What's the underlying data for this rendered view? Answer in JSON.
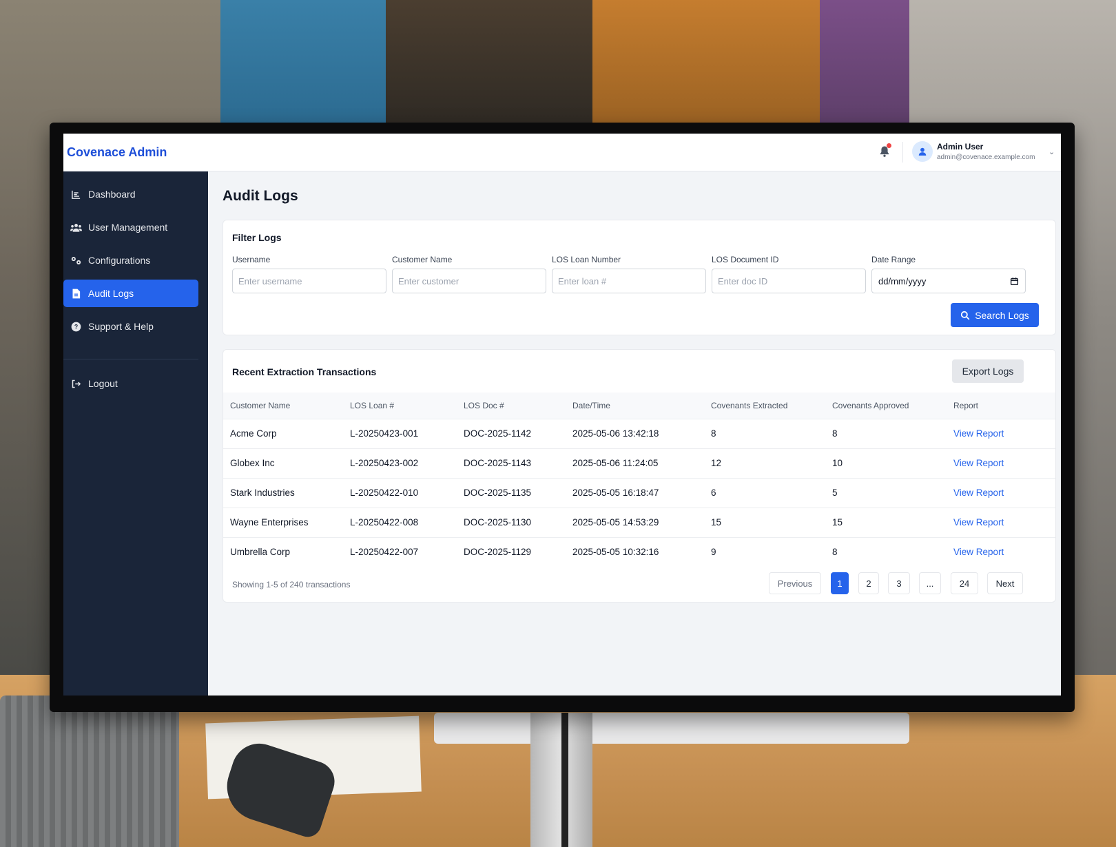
{
  "app": {
    "brand": "Covenace Admin"
  },
  "header": {
    "user_name": "Admin User",
    "user_email": "admin@covenace.example.com",
    "notification_dot_color": "#ef4444"
  },
  "sidebar": {
    "items": [
      {
        "label": "Dashboard",
        "icon": "chart-icon",
        "active": false
      },
      {
        "label": "User Management",
        "icon": "users-icon",
        "active": false
      },
      {
        "label": "Configurations",
        "icon": "gears-icon",
        "active": false
      },
      {
        "label": "Audit Logs",
        "icon": "file-icon",
        "active": true
      },
      {
        "label": "Support & Help",
        "icon": "question-icon",
        "active": false
      }
    ],
    "logout": {
      "label": "Logout",
      "icon": "logout-icon"
    }
  },
  "page": {
    "title": "Audit Logs"
  },
  "filters": {
    "title": "Filter Logs",
    "fields": [
      {
        "label": "Username",
        "placeholder": "Enter username"
      },
      {
        "label": "Customer Name",
        "placeholder": "Enter customer"
      },
      {
        "label": "LOS Loan Number",
        "placeholder": "Enter loan #"
      },
      {
        "label": "LOS Document ID",
        "placeholder": "Enter doc ID"
      }
    ],
    "date_range": {
      "label": "Date Range",
      "value": "dd/mm/yyyy"
    },
    "search_label": "Search Logs"
  },
  "transactions": {
    "title": "Recent Extraction Transactions",
    "export_label": "Export Logs",
    "columns": [
      "Customer Name",
      "LOS Loan #",
      "LOS Doc #",
      "Date/Time",
      "Covenants Extracted",
      "Covenants Approved",
      "Report"
    ],
    "rows": [
      {
        "customer": "Acme Corp",
        "loan": "L-20250423-001",
        "doc": "DOC-2025-1142",
        "datetime": "2025-05-06 13:42:18",
        "extracted": "8",
        "approved": "8",
        "report": "View Report"
      },
      {
        "customer": "Globex Inc",
        "loan": "L-20250423-002",
        "doc": "DOC-2025-1143",
        "datetime": "2025-05-06 11:24:05",
        "extracted": "12",
        "approved": "10",
        "report": "View Report"
      },
      {
        "customer": "Stark Industries",
        "loan": "L-20250422-010",
        "doc": "DOC-2025-1135",
        "datetime": "2025-05-05 16:18:47",
        "extracted": "6",
        "approved": "5",
        "report": "View Report"
      },
      {
        "customer": "Wayne Enterprises",
        "loan": "L-20250422-008",
        "doc": "DOC-2025-1130",
        "datetime": "2025-05-05 14:53:29",
        "extracted": "15",
        "approved": "15",
        "report": "View Report"
      },
      {
        "customer": "Umbrella Corp",
        "loan": "L-20250422-007",
        "doc": "DOC-2025-1129",
        "datetime": "2025-05-05 10:32:16",
        "extracted": "9",
        "approved": "8",
        "report": "View Report"
      }
    ],
    "showing": "Showing 1-5 of 240 transactions",
    "pagination": {
      "previous": "Previous",
      "pages": [
        "1",
        "2",
        "3",
        "...",
        "24"
      ],
      "next": "Next"
    }
  },
  "colors": {
    "accent": "#2563eb",
    "sidebar_bg": "#1a2539"
  }
}
